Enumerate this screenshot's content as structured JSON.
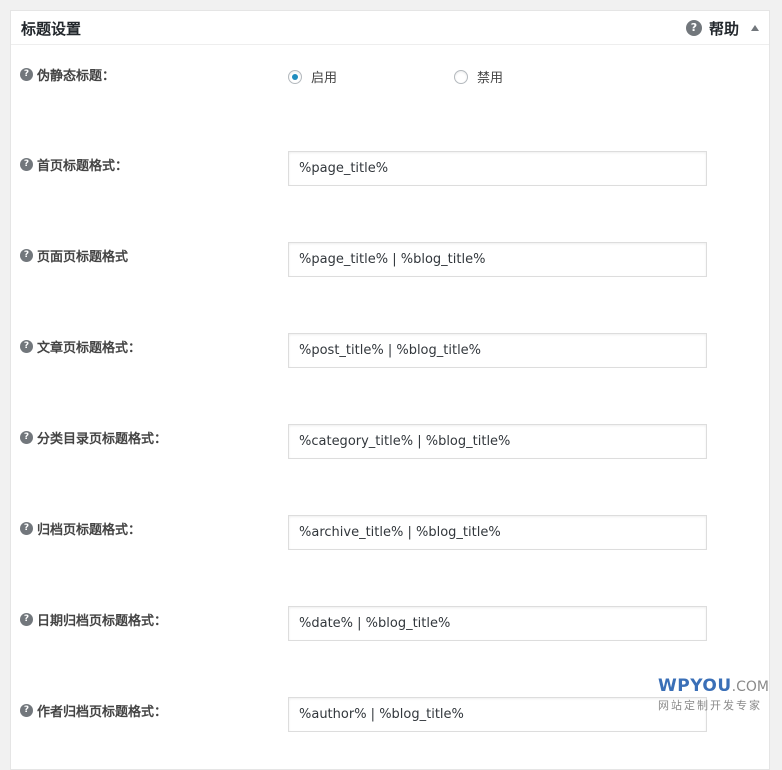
{
  "panel": {
    "title": "标题设置",
    "help_label": "帮助",
    "help_icon": "question-circle-icon"
  },
  "rows": {
    "pseudo_static": {
      "label": "伪静态标题：",
      "options": [
        {
          "label": "启用",
          "checked": true
        },
        {
          "label": "禁用",
          "checked": false
        }
      ]
    },
    "home": {
      "label": "首页标题格式：",
      "value": "%page_title%"
    },
    "page": {
      "label": "页面页标题格式",
      "value": "%page_title% | %blog_title%"
    },
    "post": {
      "label": "文章页标题格式：",
      "value": "%post_title% | %blog_title%"
    },
    "category": {
      "label": "分类目录页标题格式：",
      "value": "%category_title% | %blog_title%"
    },
    "archive": {
      "label": "归档页标题格式：",
      "value": "%archive_title% | %blog_title%"
    },
    "date": {
      "label": "日期归档页标题格式：",
      "value": "%date% | %blog_title%"
    },
    "author": {
      "label": "作者归档页标题格式：",
      "value": "%author% | %blog_title%"
    }
  },
  "watermark": {
    "brand": "WPYOU",
    "tld": ".COM",
    "tagline": "网站定制开发专家"
  },
  "colors": {
    "accent": "#1e8cbe",
    "watermark_blue": "#3a6fb7"
  }
}
